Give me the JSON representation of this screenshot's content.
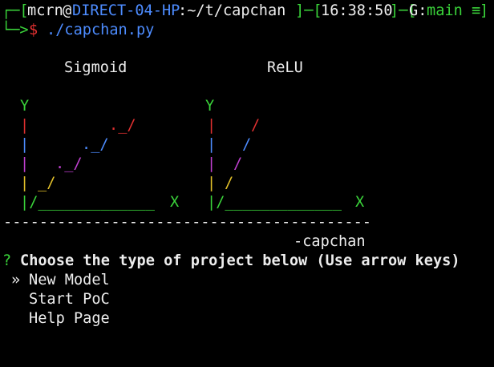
{
  "prompt": {
    "user": "mcrn",
    "at": "@",
    "host": "DIRECT-04-HP",
    "path": ":~/t/capchan",
    "time": "16:38:50",
    "git_label": "G:",
    "git_branch": "main ≡",
    "dollar": "$",
    "command": "./capchan.py"
  },
  "plots": {
    "left_title": "Sigmoid",
    "right_title": "ReLU",
    "y_label": "Y",
    "x_label": "X"
  },
  "separator": "-----------------------------------------",
  "signature": "-capchan",
  "question": {
    "marker": "?",
    "text": "Choose the type of project below (Use arrow keys)"
  },
  "menu": {
    "pointer": "»",
    "items": [
      "New Model",
      "Start PoC",
      "Help Page"
    ]
  },
  "colors": {
    "green": "#3ad33a",
    "blue": "#4d8cff",
    "red": "#e03030",
    "purple": "#c040d0",
    "yellow": "#e3c12a"
  }
}
